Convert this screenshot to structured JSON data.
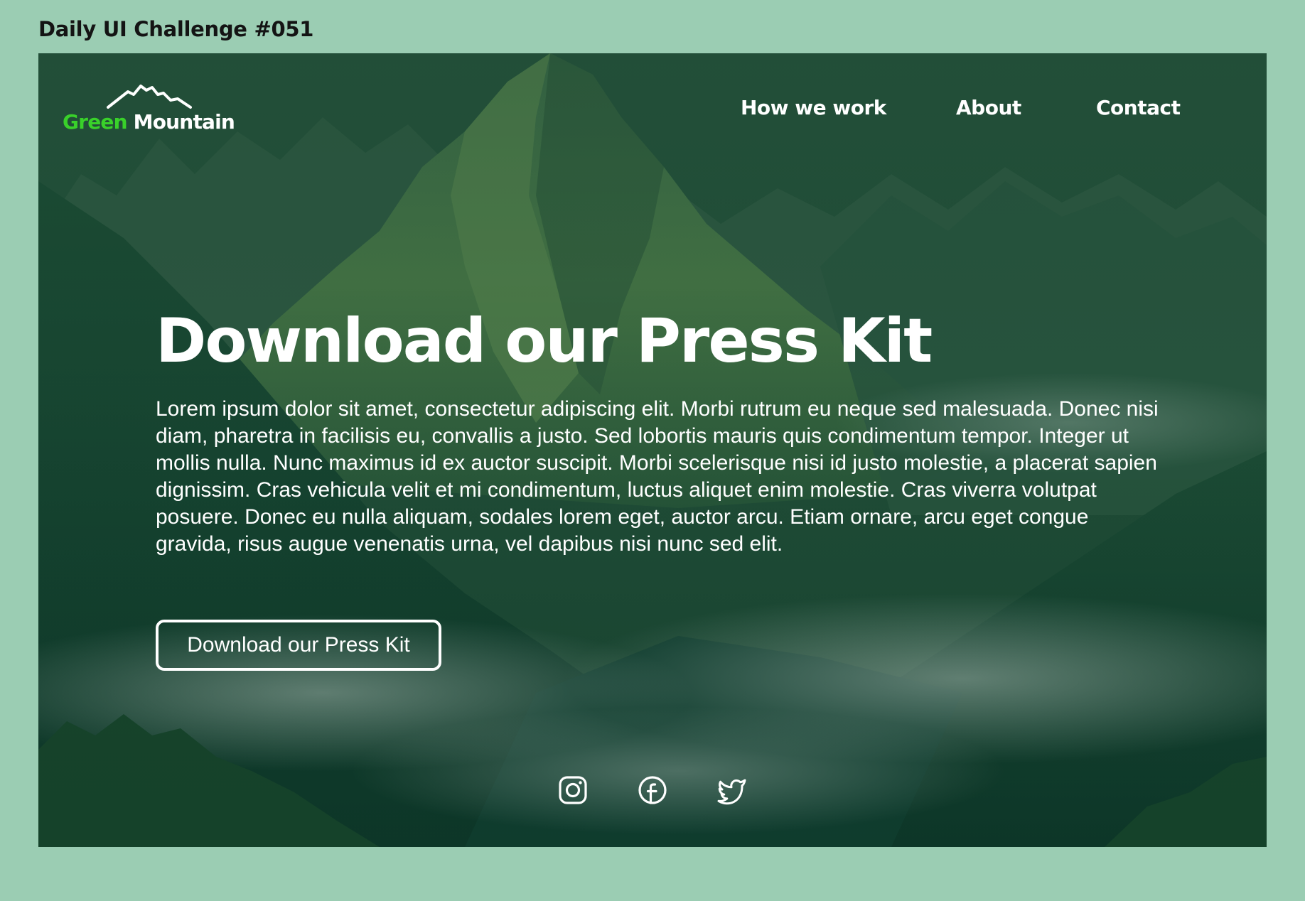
{
  "page": {
    "challenge_title": "Daily UI Challenge #051"
  },
  "brand": {
    "name_part1": "Green",
    "name_part2": "Mountain",
    "accent_color": "#39d12a"
  },
  "nav": {
    "items": [
      {
        "label": "How we work"
      },
      {
        "label": "About"
      },
      {
        "label": "Contact"
      }
    ]
  },
  "hero": {
    "headline": "Download our Press Kit",
    "body": "Lorem ipsum dolor sit amet, consectetur adipiscing elit. Morbi rutrum eu neque sed malesuada. Donec nisi diam, pharetra in facilisis eu, convallis a justo. Sed lobortis mauris quis condimentum tempor. Integer ut mollis nulla. Nunc maximus id ex auctor suscipit. Morbi scelerisque nisi id justo molestie, a placerat sapien dignissim. Cras vehicula velit et mi condimentum, luctus aliquet enim molestie. Cras viverra volutpat posuere. Donec eu nulla aliquam, sodales lorem eget, auctor arcu. Etiam ornare, arcu eget congue gravida, risus augue venenatis urna, vel dapibus nisi nunc sed elit.",
    "cta_label": "Download our Press Kit"
  },
  "social": {
    "icons": [
      "instagram-icon",
      "facebook-icon",
      "twitter-icon"
    ]
  },
  "colors": {
    "page_background": "#9bcdb3",
    "hero_overlay": "#173f2d",
    "text": "#ffffff"
  }
}
